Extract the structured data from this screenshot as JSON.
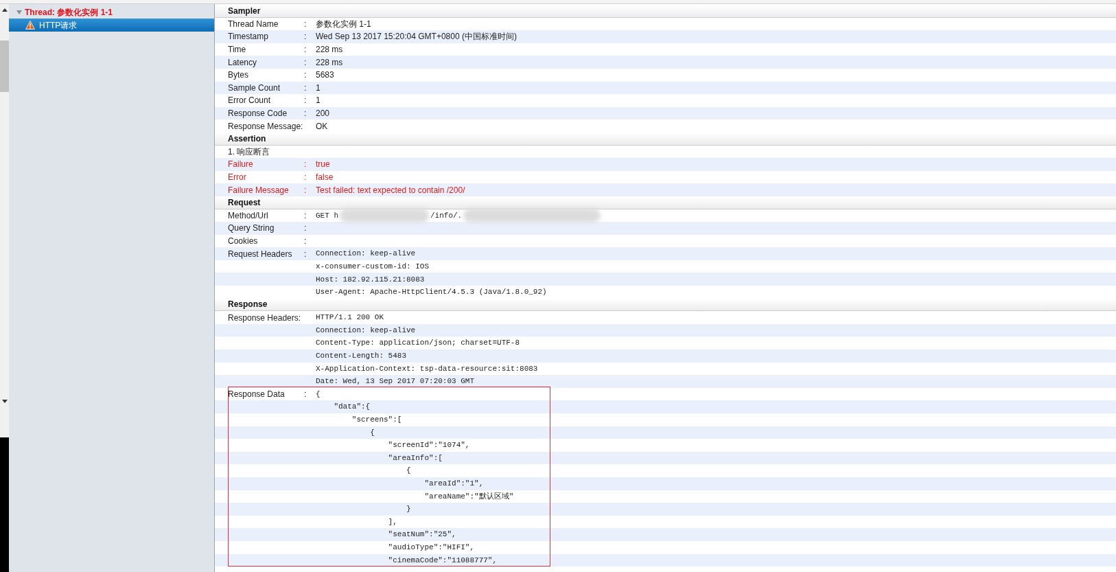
{
  "tree": {
    "items": [
      {
        "label": "Thread: 参数化实例 1-1",
        "expanded": true,
        "failed": true,
        "selected": false,
        "children": [
          {
            "label": "HTTP请求",
            "warning": true,
            "selected": true
          }
        ]
      }
    ]
  },
  "sections": [
    {
      "title": "Sampler",
      "rows": [
        {
          "label": "Thread Name",
          "sep": ":",
          "value": "参数化实例 1-1",
          "kind": "text",
          "failed": false
        },
        {
          "label": "Timestamp",
          "sep": ":",
          "value": "Wed Sep 13 2017 15:20:04 GMT+0800 (中国标准时间)",
          "kind": "text",
          "failed": false
        },
        {
          "label": "Time",
          "sep": ":",
          "value": "228 ms",
          "kind": "text",
          "failed": false
        },
        {
          "label": "Latency",
          "sep": ":",
          "value": "228 ms",
          "kind": "text",
          "failed": false
        },
        {
          "label": "Bytes",
          "sep": ":",
          "value": "5683",
          "kind": "text",
          "failed": false
        },
        {
          "label": "Sample Count",
          "sep": ":",
          "value": "1",
          "kind": "text",
          "failed": false
        },
        {
          "label": "Error Count",
          "sep": ":",
          "value": "1",
          "kind": "text",
          "failed": false
        },
        {
          "label": "Response Code",
          "sep": ":",
          "value": "200",
          "kind": "text",
          "failed": false
        },
        {
          "label": "Response Message:",
          "value": "OK",
          "kind": "text",
          "failed": false
        }
      ]
    },
    {
      "title": "Assertion",
      "rows": [
        {
          "label": "1. 响应断言",
          "kind": "text",
          "failed": false
        },
        {
          "label": "Failure",
          "sep": ":",
          "value": "true",
          "kind": "text",
          "failed": true
        },
        {
          "label": "Error",
          "sep": ":",
          "value": "false",
          "kind": "text",
          "failed": true
        },
        {
          "label": "Failure Message",
          "sep": ":",
          "value": "Test failed: text expected to contain /200/",
          "kind": "text",
          "failed": true
        }
      ]
    },
    {
      "title": "Request",
      "rows": [
        {
          "label": "Method/Url",
          "sep": ":",
          "parts": [
            "GET h",
            "/info/."
          ],
          "redacted": true,
          "kind": "code",
          "failed": false
        },
        {
          "label": "Query String",
          "sep": ":",
          "kind": "code",
          "failed": false
        },
        {
          "label": "Cookies",
          "sep": ":",
          "kind": "code",
          "failed": false
        },
        {
          "label": "Request Headers",
          "sep": ":",
          "value": "Connection: keep-alive",
          "kind": "code",
          "failed": false
        },
        {
          "value": "x-consumer-custom-id: IOS",
          "kind": "code",
          "failed": false
        },
        {
          "value": "Host: 182.92.115.21:8083",
          "kind": "code",
          "failed": false
        },
        {
          "value": "User-Agent: Apache-HttpClient/4.5.3 (Java/1.8.0_92)",
          "kind": "code",
          "failed": false
        }
      ]
    },
    {
      "title": "Response",
      "rows": [
        {
          "label": "Response Headers:",
          "value": "HTTP/1.1 200 OK",
          "kind": "code",
          "failed": false
        },
        {
          "value": "Connection: keep-alive",
          "kind": "code",
          "failed": false
        },
        {
          "value": "Content-Type: application/json; charset=UTF-8",
          "kind": "code",
          "failed": false
        },
        {
          "value": "Content-Length: 5483",
          "kind": "code",
          "failed": false
        },
        {
          "value": "X-Application-Context: tsp-data-resource:sit:8083",
          "kind": "code",
          "failed": false
        },
        {
          "value": "Date: Wed, 13 Sep 2017 07:20:03 GMT",
          "kind": "code",
          "failed": false
        }
      ],
      "highlighted": true,
      "data_rows": [
        {
          "label": "Response Data",
          "sep": ":",
          "value": "{",
          "kind": "code",
          "failed": false
        },
        {
          "value": "    \"data\":{",
          "kind": "code",
          "failed": false
        },
        {
          "value": "        \"screens\":[",
          "kind": "code",
          "failed": false
        },
        {
          "value": "            {",
          "kind": "code",
          "failed": false
        },
        {
          "value": "                \"screenId\":\"1074\",",
          "kind": "code",
          "failed": false
        },
        {
          "value": "                \"areaInfo\":[",
          "kind": "code",
          "failed": false
        },
        {
          "value": "                    {",
          "kind": "code",
          "failed": false
        },
        {
          "value": "                        \"areaId\":\"1\",",
          "kind": "code",
          "failed": false
        },
        {
          "value": "                        \"areaName\":\"默认区域\"",
          "kind": "code",
          "failed": false
        },
        {
          "value": "                    }",
          "kind": "code",
          "failed": false
        },
        {
          "value": "                ],",
          "kind": "code",
          "failed": false
        },
        {
          "value": "                \"seatNum\":\"25\",",
          "kind": "code",
          "failed": false
        },
        {
          "value": "                \"audioType\":\"HIFI\",",
          "kind": "code",
          "failed": false
        },
        {
          "value": "                \"cinemaCode\":\"11088777\",",
          "kind": "code",
          "failed": false
        }
      ]
    }
  ]
}
